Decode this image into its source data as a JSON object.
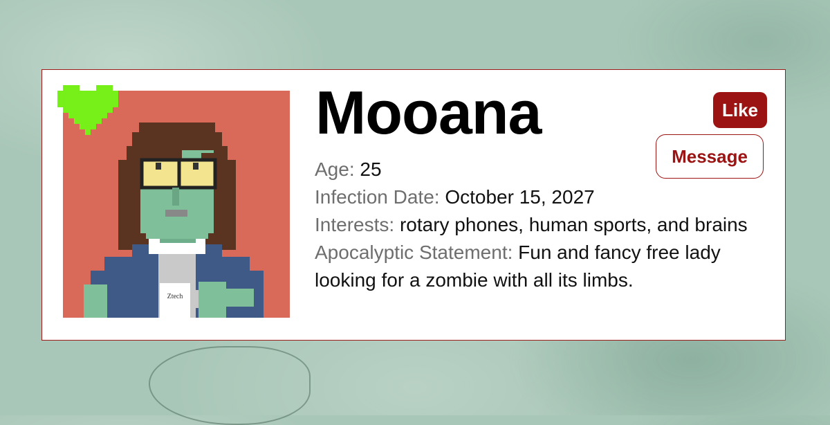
{
  "profile": {
    "name": "Mooana",
    "age_label": "Age:",
    "age": "25",
    "infection_label": "Infection Date:",
    "infection_date": "October 15, 2027",
    "interests_label": "Interests:",
    "interests": "rotary phones, human sports, and brains",
    "statement_label": "Apocalyptic Statement:",
    "statement": "Fun and fancy free lady looking for a zombie with all its limbs.",
    "mug_text": "Ztech"
  },
  "actions": {
    "like_label": "Like",
    "message_label": "Message"
  },
  "colors": {
    "accent": "#9b1313",
    "portrait_bg": "#d96a5a",
    "skin": "#7fbf9a",
    "hair": "#5a3420",
    "heart": "#77f01a"
  }
}
